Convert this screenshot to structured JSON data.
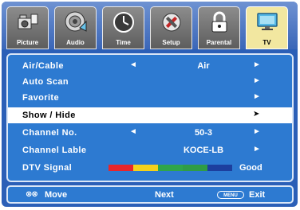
{
  "tabs": [
    {
      "label": "Picture",
      "icon": "camera-icon",
      "active": false
    },
    {
      "label": "Audio",
      "icon": "speaker-icon",
      "active": false
    },
    {
      "label": "Time",
      "icon": "clock-icon",
      "active": false
    },
    {
      "label": "Setup",
      "icon": "tools-icon",
      "active": false
    },
    {
      "label": "Parental",
      "icon": "lock-icon",
      "active": false
    },
    {
      "label": "TV",
      "icon": "tv-icon",
      "active": true
    }
  ],
  "menu": {
    "air_cable": {
      "label": "Air/Cable",
      "value": "Air",
      "left_arrow": "◄",
      "right_arrow": "►"
    },
    "auto_scan": {
      "label": "Auto Scan",
      "right_arrow": "►"
    },
    "favorite": {
      "label": "Favorite",
      "right_arrow": "►"
    },
    "show_hide": {
      "label": "Show / Hide",
      "right_arrow": "➤",
      "selected": true
    },
    "channel_no": {
      "label": "Channel No.",
      "value": "50-3",
      "left_arrow": "◄",
      "right_arrow": "►"
    },
    "channel_lable": {
      "label": "Channel Lable",
      "value": "KOCE-LB",
      "right_arrow": "►"
    },
    "dtv_signal": {
      "label": "DTV Signal",
      "status": "Good",
      "segments": [
        "#e8262b",
        "#f4d11b",
        "#2fa54a",
        "#2f9c45",
        "#1c3f9e"
      ]
    }
  },
  "help": {
    "move_label": "Move",
    "next_label": "Next",
    "menu_key": "MENU",
    "exit_label": "Exit"
  },
  "colors": {
    "frame": "#2b5fb7",
    "panel": "#2d7ad1",
    "selected_row": "#ffffff"
  }
}
